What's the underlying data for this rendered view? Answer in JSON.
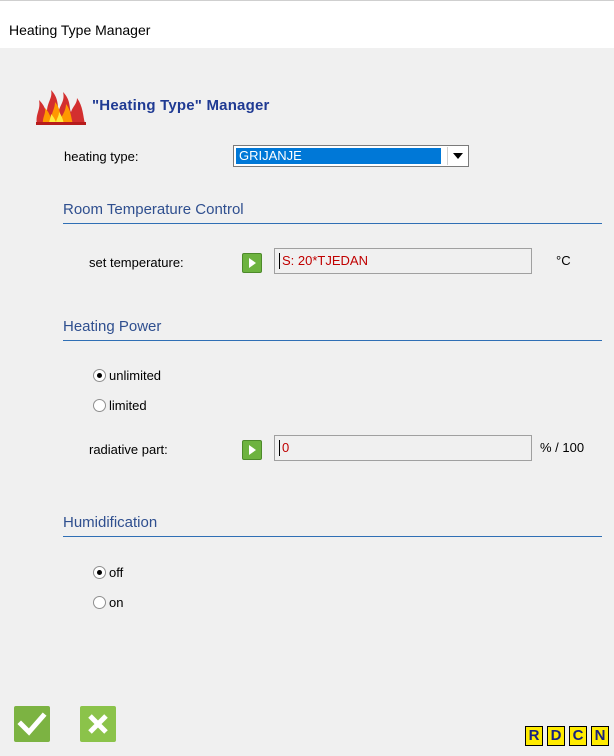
{
  "window": {
    "title": "Heating Type Manager"
  },
  "header": {
    "title": "\"Heating Type\" Manager",
    "icon": "flame-icon"
  },
  "heating_type": {
    "label": "heating type:",
    "value": "GRIJANJE"
  },
  "room_temp": {
    "section_title": "Room Temperature Control",
    "label": "set temperature:",
    "value": "S: 20*TJEDAN",
    "unit": "°C"
  },
  "heating_power": {
    "section_title": "Heating Power",
    "options": [
      {
        "label": "unlimited",
        "checked": true
      },
      {
        "label": "limited",
        "checked": false
      }
    ],
    "radiative_label": "radiative part:",
    "radiative_value": "0",
    "radiative_unit": "% / 100"
  },
  "humidification": {
    "section_title": "Humidification",
    "options": [
      {
        "label": "off",
        "checked": true
      },
      {
        "label": "on",
        "checked": false
      }
    ]
  },
  "footer": {
    "ok_icon": "checkmark-icon",
    "cancel_icon": "x-icon",
    "letter_buttons": [
      "R",
      "D",
      "C",
      "N"
    ]
  },
  "colors": {
    "section_title": "#2f4f8f",
    "section_line": "#2f6fb5",
    "header_title": "#1f3a93",
    "field_text": "#c00000",
    "select_highlight": "#0078d7",
    "play_button": "#6db33f",
    "ok_button": "#7cb342",
    "letter_button": "#ffeb00"
  }
}
